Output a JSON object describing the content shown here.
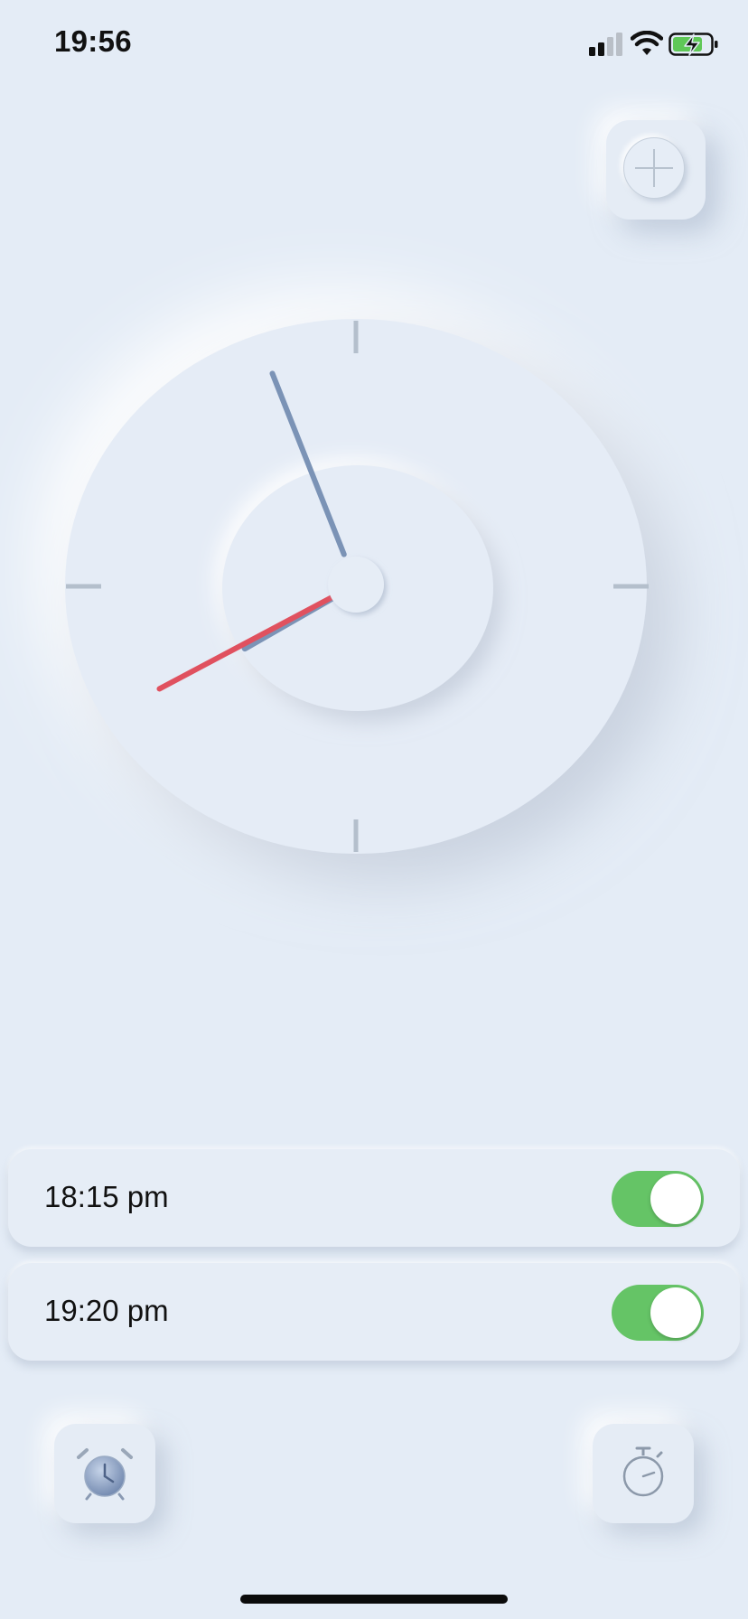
{
  "status_bar": {
    "time": "19:56",
    "icons": [
      "signal-icon",
      "wifi-icon",
      "battery-charging-icon"
    ]
  },
  "header": {
    "add_icon": "plus-icon"
  },
  "clock": {
    "hour": 19,
    "minute": 56,
    "second": 40,
    "hand_colors": {
      "hour": "#7b93b6",
      "minute": "#7b93b6",
      "second": "#e0515f"
    }
  },
  "alarms": [
    {
      "time": "18:15 pm",
      "enabled": true
    },
    {
      "time": "19:20 pm",
      "enabled": true
    }
  ],
  "bottom_nav": {
    "left_icon": "alarm-clock-icon",
    "right_icon": "stopwatch-icon"
  },
  "colors": {
    "background": "#e4ecf6",
    "toggle_on": "#65c466",
    "battery": "#5fc857"
  }
}
